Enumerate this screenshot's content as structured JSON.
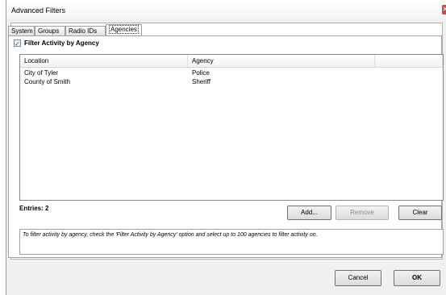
{
  "window": {
    "title": "Advanced Filters"
  },
  "tabs": [
    {
      "label": "System"
    },
    {
      "label": "Groups"
    },
    {
      "label": "Radio IDs"
    },
    {
      "label": "Agencies"
    }
  ],
  "filter": {
    "checkbox_label": "Filter Activity by Agency",
    "checked": true
  },
  "list": {
    "columns": [
      "Location",
      "Agency"
    ],
    "rows": [
      {
        "location": "City of Tyler",
        "agency": "Police"
      },
      {
        "location": "County of Smith",
        "agency": "Sheriff"
      }
    ]
  },
  "entries_label": "Entries: 2",
  "buttons": {
    "add": "Add...",
    "remove": "Remove",
    "clear": "Clear",
    "cancel": "Cancel",
    "ok": "OK"
  },
  "hint": "To filter activity by agency, check the 'Filter Activity by Agency' option and select up to 100 agencies to filter activity on."
}
